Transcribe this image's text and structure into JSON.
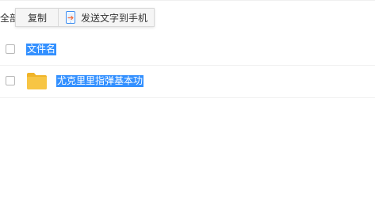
{
  "select_all_partial": "全部",
  "toolbar": {
    "copy_label": "复制",
    "send_label": "发送文字到手机",
    "send_icon": "phone-transfer-icon"
  },
  "table": {
    "header_label": "文件名",
    "rows": [
      {
        "name": "尤克里里指弹基本功",
        "icon": "folder-icon",
        "folder_color": "#f7c544"
      }
    ]
  },
  "colors": {
    "selection": "#3390ff",
    "folder": "#f7c544",
    "toolbar_bg": "#f5f5f5"
  }
}
